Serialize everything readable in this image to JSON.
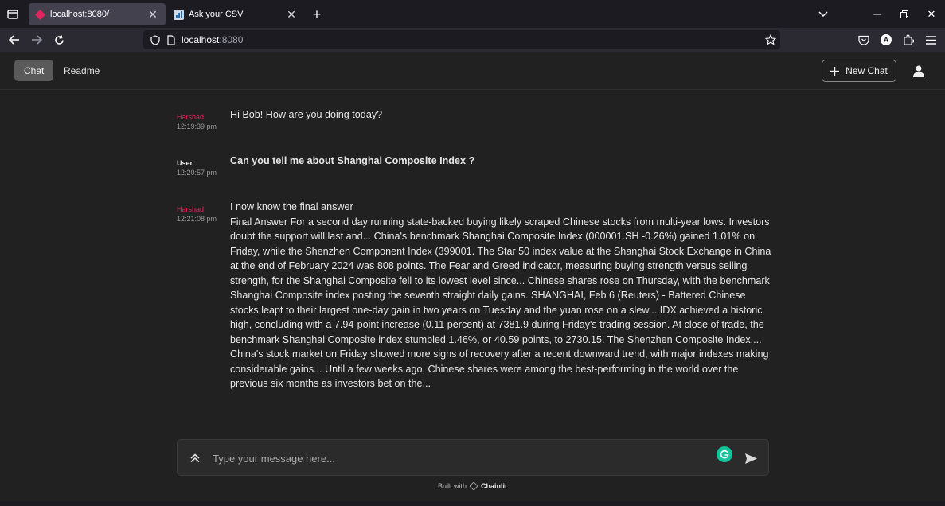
{
  "browser": {
    "tabs": [
      {
        "title": "localhost:8080/",
        "active": true
      },
      {
        "title": "Ask your CSV",
        "active": false
      }
    ],
    "url_host": "localhost",
    "url_port": ":8080"
  },
  "app": {
    "nav": [
      "Chat",
      "Readme"
    ],
    "new_chat_label": "New Chat"
  },
  "messages": [
    {
      "author": "Harshad",
      "time": "12:19:39 pm",
      "text": "Hi Bob! How are you doing today?",
      "role": "assistant"
    },
    {
      "author": "User",
      "time": "12:20:57 pm",
      "text": "Can you tell me about Shanghai Composite Index ?",
      "role": "user"
    },
    {
      "author": "Harshad",
      "time": "12:21:08 pm",
      "role": "assistant",
      "line1": "I now know the final answer",
      "text": "Final Answer For a second day running state-backed buying likely scraped Chinese stocks from multi-year lows. Investors doubt the support will last and... China's benchmark Shanghai Composite Index (000001.SH -0.26%) gained 1.01% on Friday, while the Shenzhen Component Index (399001. The Star 50 index value at the Shanghai Stock Exchange in China at the end of February 2024 was 808 points. The Fear and Greed indicator, measuring buying strength versus selling strength, for the Shanghai Composite fell to its lowest level since... Chinese shares rose on Thursday, with the benchmark Shanghai Composite index posting the seventh straight daily gains. SHANGHAI, Feb 6 (Reuters) - Battered Chinese stocks leapt to their largest one-day gain in two years on Tuesday and the yuan rose on a slew... IDX achieved a historic high, concluding with a 7.94-point increase (0.11 percent) at 7381.9 during Friday's trading session. At close of trade, the benchmark Shanghai Composite index stumbled 1.46%, or 40.59 points, to 2730.15. The Shenzhen Composite Index,... China's stock market on Friday showed more signs of recovery after a recent downward trend, with major indexes making considerable gains... Until a few weeks ago, Chinese shares were among the best-performing in the world over the previous six months as investors bet on the..."
    }
  ],
  "composer": {
    "placeholder": "Type your message here..."
  },
  "footer": {
    "prefix": "Built with",
    "brand": "Chainlit"
  },
  "colors": {
    "assistant_author": "#e0245e",
    "background": "#212121",
    "grammarly": "#15c39a"
  }
}
